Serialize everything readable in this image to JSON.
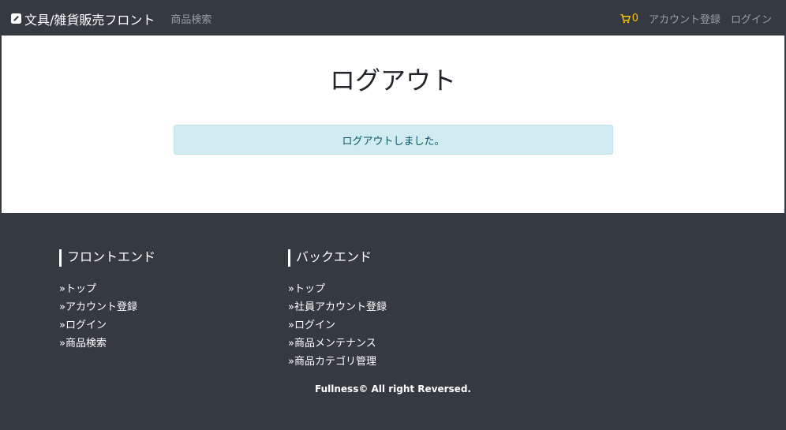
{
  "navbar": {
    "brand": "文具/雑貨販売フロント",
    "brand_icon": "pencil-square-icon",
    "search_link": "商品検索",
    "cart_count": "0",
    "cart_icon": "cart-icon",
    "register_link": "アカウント登録",
    "login_link": "ログイン",
    "accent_color": "#ffc107"
  },
  "main": {
    "title": "ログアウト",
    "alert_message": "ログアウトしました。",
    "alert_bg": "#d1ecf1"
  },
  "footer": {
    "front": {
      "heading": "フロントエンド",
      "items": [
        {
          "prefix": "»",
          "label": "トップ"
        },
        {
          "prefix": "»",
          "label": "アカウント登録"
        },
        {
          "prefix": "»",
          "label": "ログイン"
        },
        {
          "prefix": "»",
          "label": "商品検索"
        }
      ]
    },
    "back": {
      "heading": "バックエンド",
      "items": [
        {
          "prefix": "»",
          "label": "トップ"
        },
        {
          "prefix": "»",
          "label": "社員アカウント登録"
        },
        {
          "prefix": "»",
          "label": "ログイン"
        },
        {
          "prefix": "»",
          "label": "商品メンテナンス"
        },
        {
          "prefix": "»",
          "label": "商品カテゴリ管理"
        }
      ]
    },
    "copyright": "Fullness© All right Reversed.",
    "bg_color": "#343a40"
  }
}
